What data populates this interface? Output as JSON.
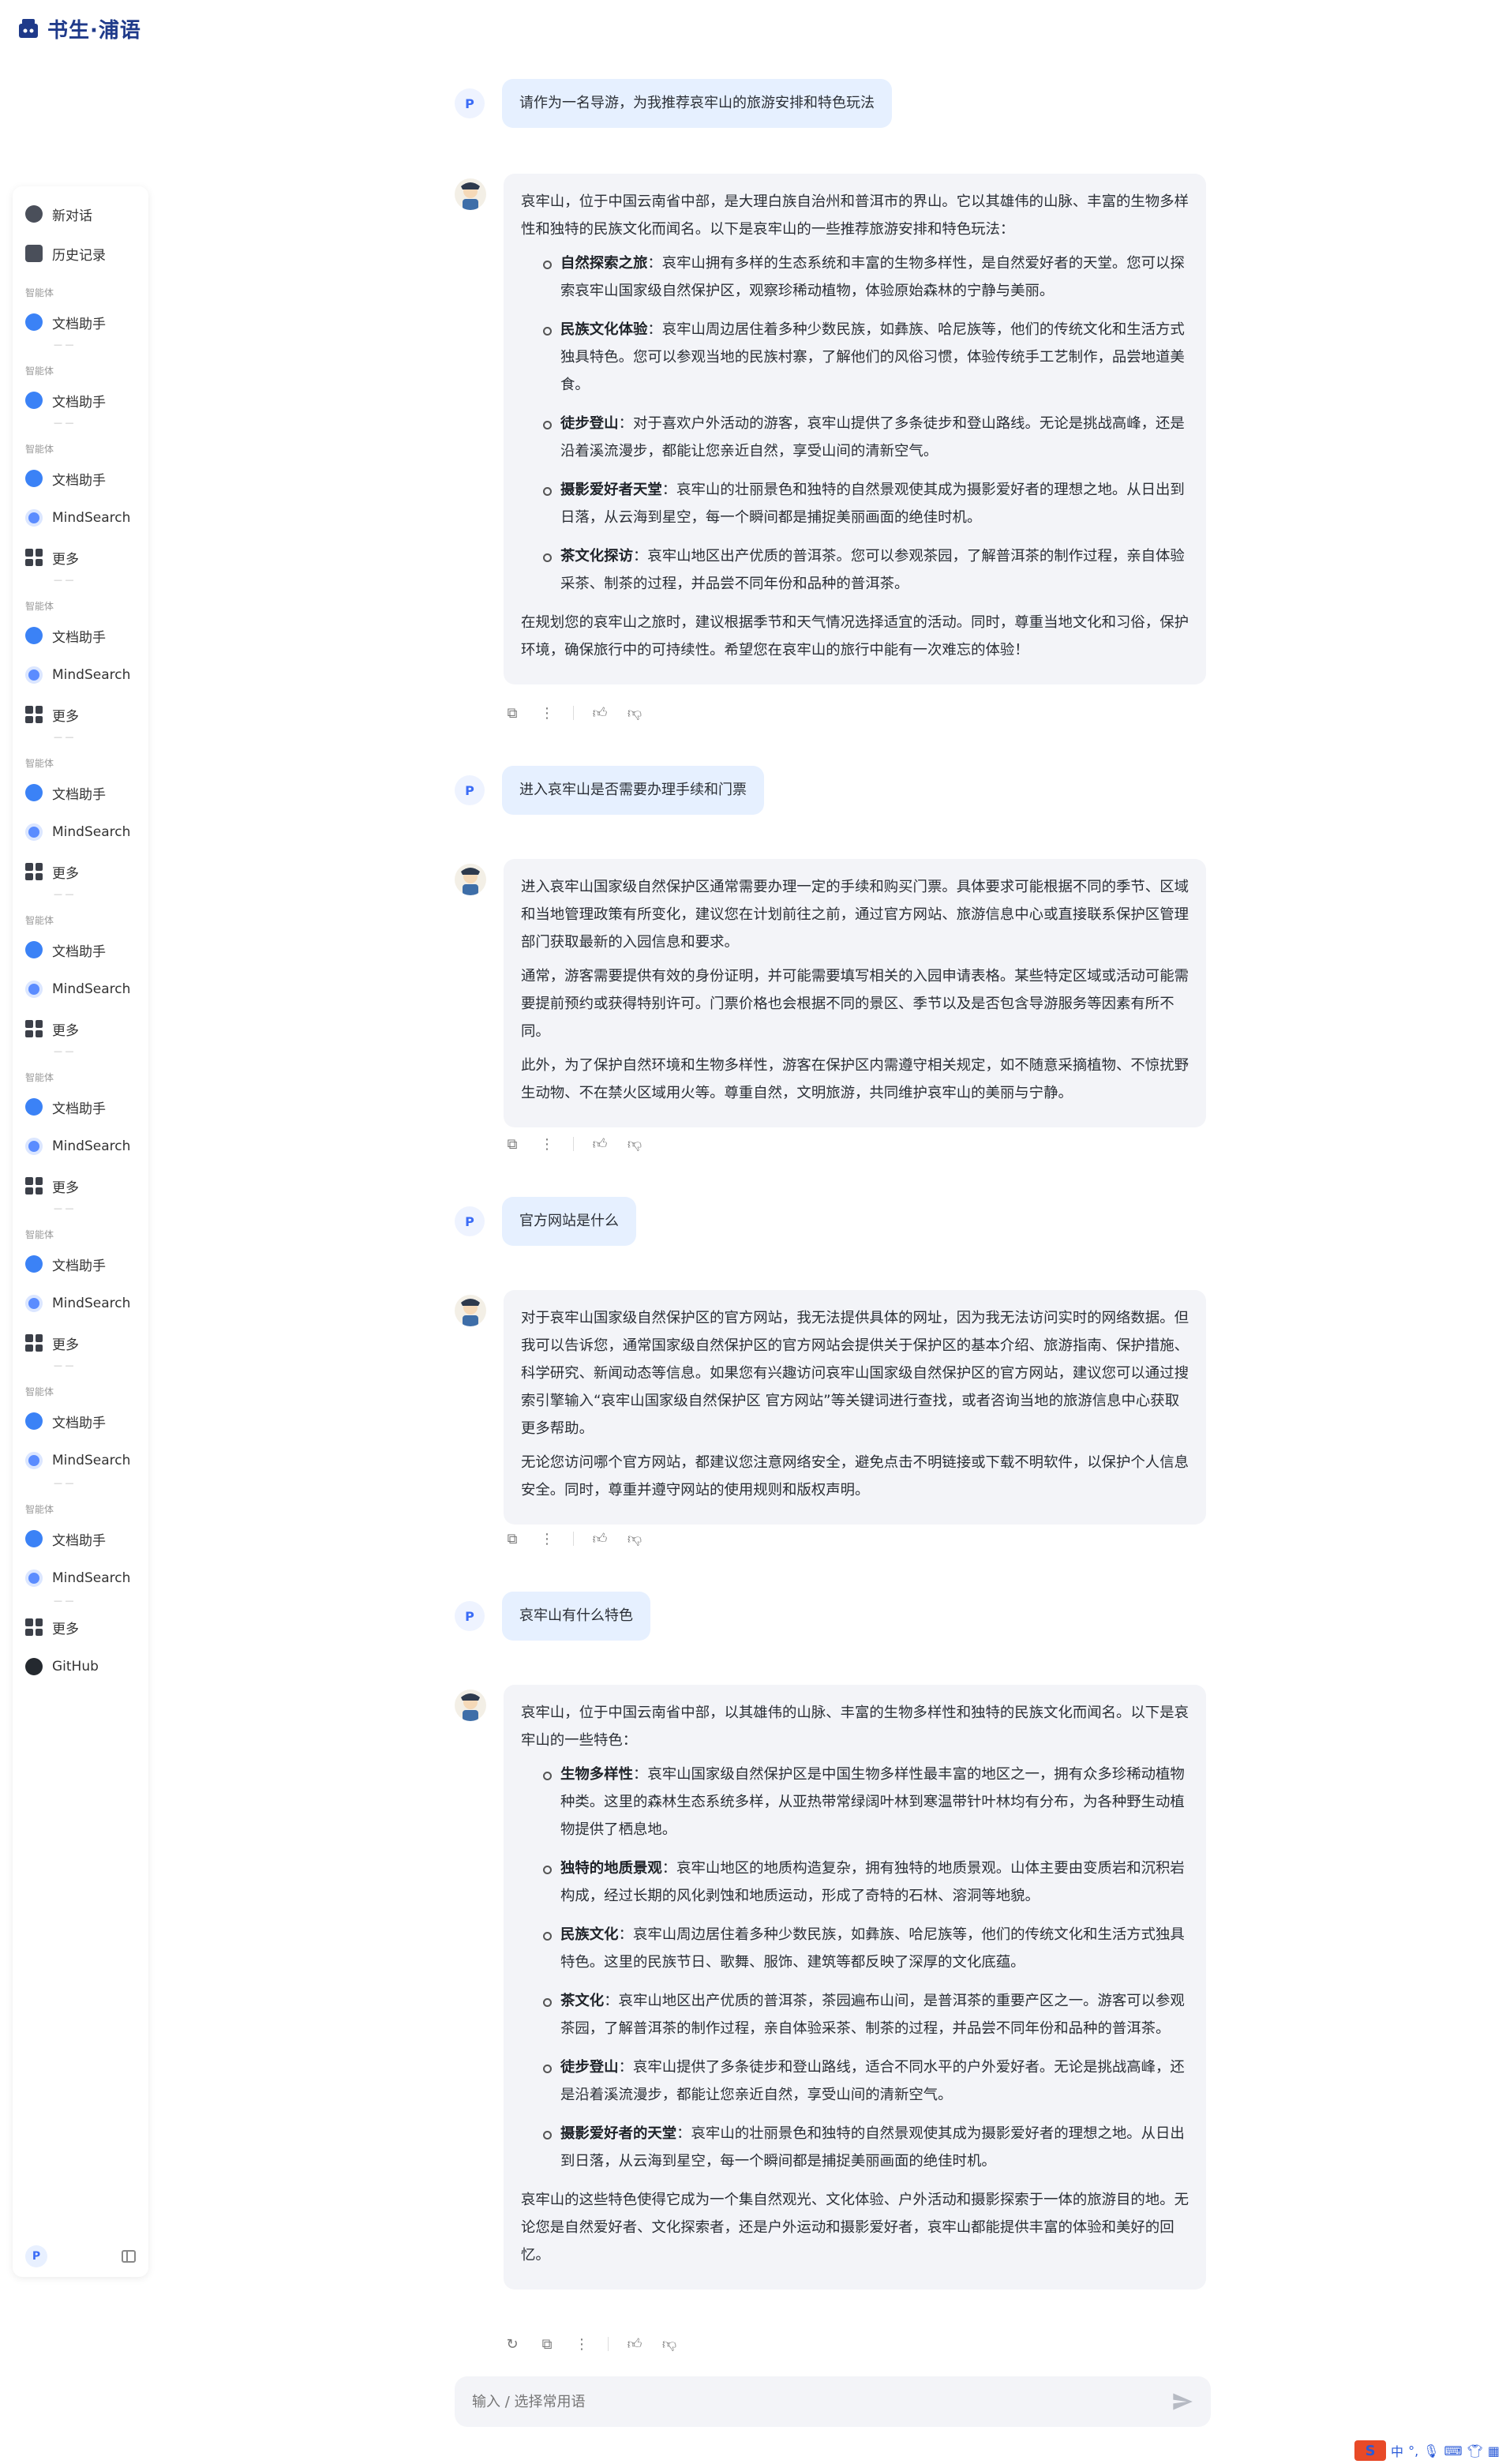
{
  "app": {
    "title": "书生·浦语"
  },
  "sidebar": {
    "new_chat": "新对话",
    "history": "历史记录",
    "section_label": "智能体",
    "dash": "— —",
    "doc_assistant": "文档助手",
    "mindsearch": "MindSearch",
    "more": "更多",
    "github": "GitHub",
    "avatar": "P"
  },
  "user_avatar": "P",
  "messages": [
    {
      "role": "user",
      "text": "请作为一名导游，为我推荐哀牢山的旅游安排和特色玩法"
    },
    {
      "role": "bot",
      "intro": "哀牢山，位于中国云南省中部，是大理白族自治州和普洱市的界山。它以其雄伟的山脉、丰富的生物多样性和独特的民族文化而闻名。以下是哀牢山的一些推荐旅游安排和特色玩法：",
      "items": [
        {
          "title": "自然探索之旅",
          "text": "：哀牢山拥有多样的生态系统和丰富的生物多样性，是自然爱好者的天堂。您可以探索哀牢山国家级自然保护区，观察珍稀动植物，体验原始森林的宁静与美丽。"
        },
        {
          "title": "民族文化体验",
          "text": "：哀牢山周边居住着多种少数民族，如彝族、哈尼族等，他们的传统文化和生活方式独具特色。您可以参观当地的民族村寨，了解他们的风俗习惯，体验传统手工艺制作，品尝地道美食。"
        },
        {
          "title": "徒步登山",
          "text": "：对于喜欢户外活动的游客，哀牢山提供了多条徒步和登山路线。无论是挑战高峰，还是沿着溪流漫步，都能让您亲近自然，享受山间的清新空气。"
        },
        {
          "title": "摄影爱好者天堂",
          "text": "：哀牢山的壮丽景色和独特的自然景观使其成为摄影爱好者的理想之地。从日出到日落，从云海到星空，每一个瞬间都是捕捉美丽画面的绝佳时机。"
        },
        {
          "title": "茶文化探访",
          "text": "：哀牢山地区出产优质的普洱茶。您可以参观茶园，了解普洱茶的制作过程，亲自体验采茶、制茶的过程，并品尝不同年份和品种的普洱茶。"
        }
      ],
      "outro": "在规划您的哀牢山之旅时，建议根据季节和天气情况选择适宜的活动。同时，尊重当地文化和习俗，保护环境，确保旅行中的可持续性。希望您在哀牢山的旅行中能有一次难忘的体验！"
    },
    {
      "role": "user",
      "text": "进入哀牢山是否需要办理手续和门票"
    },
    {
      "role": "bot",
      "paragraphs": [
        "进入哀牢山国家级自然保护区通常需要办理一定的手续和购买门票。具体要求可能根据不同的季节、区域和当地管理政策有所变化，建议您在计划前往之前，通过官方网站、旅游信息中心或直接联系保护区管理部门获取最新的入园信息和要求。",
        "通常，游客需要提供有效的身份证明，并可能需要填写相关的入园申请表格。某些特定区域或活动可能需要提前预约或获得特别许可。门票价格也会根据不同的景区、季节以及是否包含导游服务等因素有所不同。",
        "此外，为了保护自然环境和生物多样性，游客在保护区内需遵守相关规定，如不随意采摘植物、不惊扰野生动物、不在禁火区域用火等。尊重自然，文明旅游，共同维护哀牢山的美丽与宁静。"
      ]
    },
    {
      "role": "user",
      "text": "官方网站是什么"
    },
    {
      "role": "bot",
      "paragraphs": [
        "对于哀牢山国家级自然保护区的官方网站，我无法提供具体的网址，因为我无法访问实时的网络数据。但我可以告诉您，通常国家级自然保护区的官方网站会提供关于保护区的基本介绍、旅游指南、保护措施、科学研究、新闻动态等信息。如果您有兴趣访问哀牢山国家级自然保护区的官方网站，建议您可以通过搜索引擎输入“哀牢山国家级自然保护区 官方网站”等关键词进行查找，或者咨询当地的旅游信息中心获取更多帮助。",
        "无论您访问哪个官方网站，都建议您注意网络安全，避免点击不明链接或下载不明软件，以保护个人信息安全。同时，尊重并遵守网站的使用规则和版权声明。"
      ]
    },
    {
      "role": "user",
      "text": "哀牢山有什么特色"
    },
    {
      "role": "bot",
      "intro": "哀牢山，位于中国云南省中部，以其雄伟的山脉、丰富的生物多样性和独特的民族文化而闻名。以下是哀牢山的一些特色：",
      "items": [
        {
          "title": "生物多样性",
          "text": "：哀牢山国家级自然保护区是中国生物多样性最丰富的地区之一，拥有众多珍稀动植物种类。这里的森林生态系统多样，从亚热带常绿阔叶林到寒温带针叶林均有分布，为各种野生动植物提供了栖息地。"
        },
        {
          "title": "独特的地质景观",
          "text": "：哀牢山地区的地质构造复杂，拥有独特的地质景观。山体主要由变质岩和沉积岩构成，经过长期的风化剥蚀和地质运动，形成了奇特的石林、溶洞等地貌。"
        },
        {
          "title": "民族文化",
          "text": "：哀牢山周边居住着多种少数民族，如彝族、哈尼族等，他们的传统文化和生活方式独具特色。这里的民族节日、歌舞、服饰、建筑等都反映了深厚的文化底蕴。"
        },
        {
          "title": "茶文化",
          "text": "：哀牢山地区出产优质的普洱茶，茶园遍布山间，是普洱茶的重要产区之一。游客可以参观茶园，了解普洱茶的制作过程，亲自体验采茶、制茶的过程，并品尝不同年份和品种的普洱茶。"
        },
        {
          "title": "徒步登山",
          "text": "：哀牢山提供了多条徒步和登山路线，适合不同水平的户外爱好者。无论是挑战高峰，还是沿着溪流漫步，都能让您亲近自然，享受山间的清新空气。"
        },
        {
          "title": "摄影爱好者的天堂",
          "text": "：哀牢山的壮丽景色和独特的自然景观使其成为摄影爱好者的理想之地。从日出到日落，从云海到星空，每一个瞬间都是捕捉美丽画面的绝佳时机。"
        }
      ],
      "outro": "哀牢山的这些特色使得它成为一个集自然观光、文化体验、户外活动和摄影探索于一体的旅游目的地。无论您是自然爱好者、文化探索者，还是户外运动和摄影爱好者，哀牢山都能提供丰富的体验和美好的回忆。"
    }
  ],
  "input": {
    "placeholder": "输入 / 选择常用语"
  },
  "tray": {
    "logo": "S",
    "lang": "中"
  }
}
